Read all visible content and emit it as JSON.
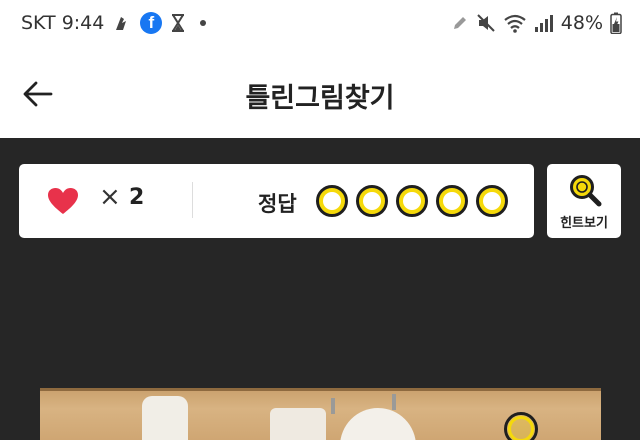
{
  "status_bar": {
    "carrier_time": "SKT 9:44",
    "battery": "48%"
  },
  "header": {
    "title": "틀린그림찾기"
  },
  "score": {
    "times_symbol": "×",
    "lives": "2",
    "answer_label": "정답",
    "answers_total": 5,
    "answers_found": 0
  },
  "hint_button": {
    "label": "힌트보기"
  },
  "colors": {
    "background": "#262626",
    "accent_yellow": "#f5d90a",
    "heart_red": "#e8324b"
  }
}
